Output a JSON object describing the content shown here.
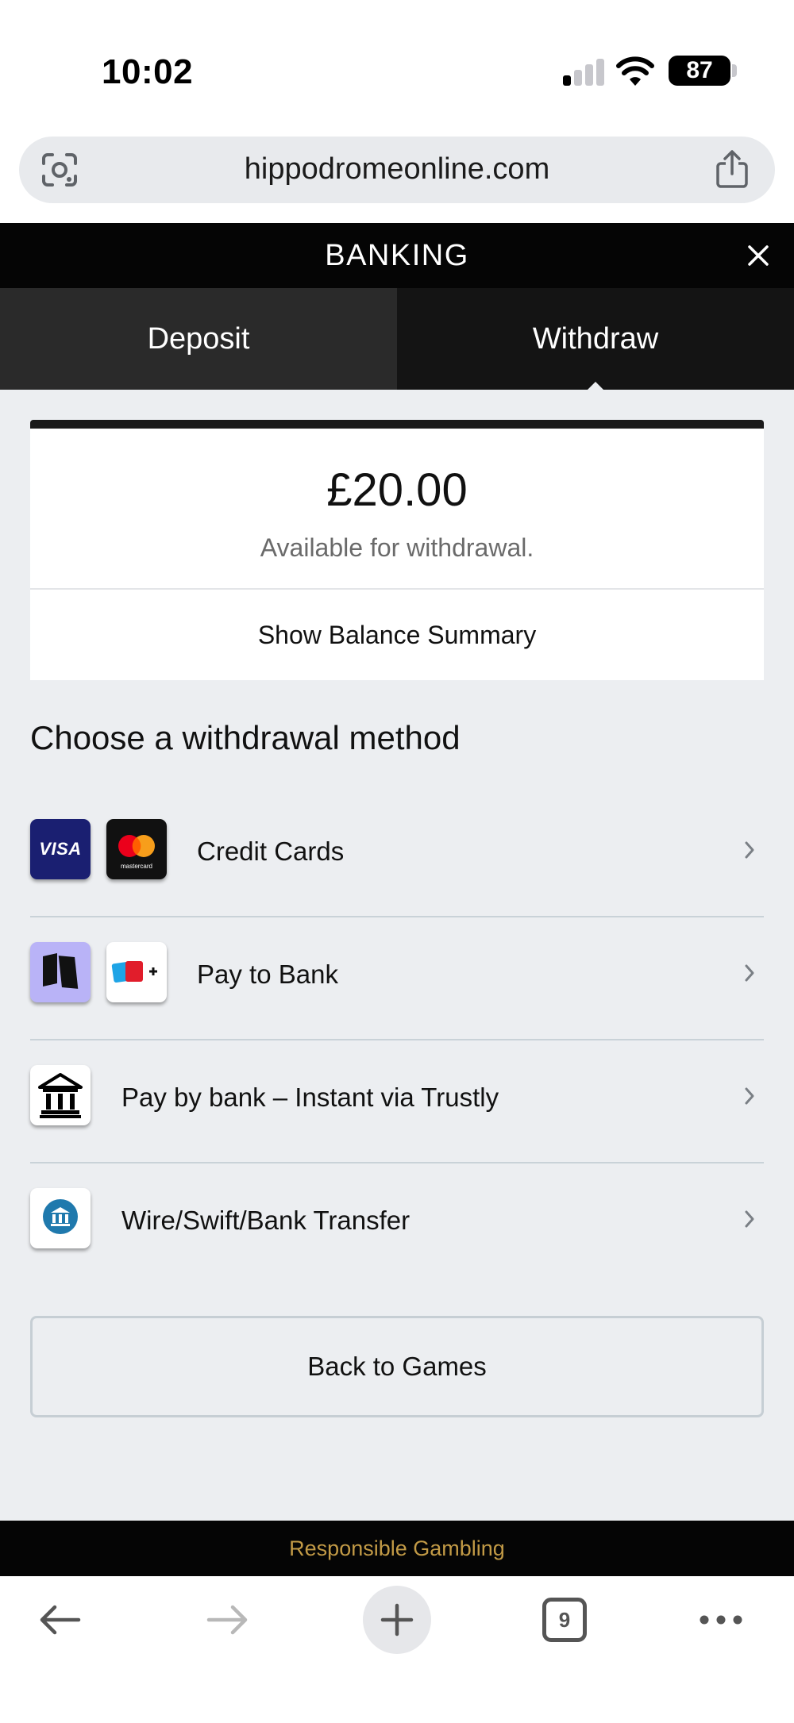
{
  "status_bar": {
    "time": "10:02",
    "battery_level": "87"
  },
  "browser": {
    "url": "hippodromeonline.com",
    "open_tabs": "9"
  },
  "header": {
    "title": "BANKING"
  },
  "tabs": [
    {
      "label": "Deposit",
      "active": false
    },
    {
      "label": "Withdraw",
      "active": true
    }
  ],
  "balance": {
    "amount": "£20.00",
    "caption": "Available for withdrawal.",
    "summary_label": "Show Balance Summary"
  },
  "withdrawal": {
    "heading": "Choose a withdrawal method",
    "methods": [
      {
        "label": "Credit Cards",
        "icons": [
          "visa-icon",
          "mastercard-icon"
        ]
      },
      {
        "label": "Pay to Bank",
        "icons": [
          "payto-icon",
          "bank-logos-icon"
        ]
      },
      {
        "label": "Pay by bank – Instant via Trustly",
        "icons": [
          "bank-building-icon"
        ]
      },
      {
        "label": "Wire/Swift/Bank Transfer",
        "icons": [
          "wire-transfer-icon"
        ]
      }
    ]
  },
  "actions": {
    "back_label": "Back to Games"
  },
  "footer": {
    "responsible_gambling": "Responsible Gambling"
  },
  "icon_text": {
    "visa": "VISA",
    "mastercard": "mastercard"
  },
  "colors": {
    "header_bg": "#050505",
    "tab_inactive_bg": "#2a2a2a",
    "tab_active_bg": "#141414",
    "page_bg": "#eceef1",
    "responsible_gambling_text": "#c29a46",
    "visa_bg": "#1a1f71"
  }
}
